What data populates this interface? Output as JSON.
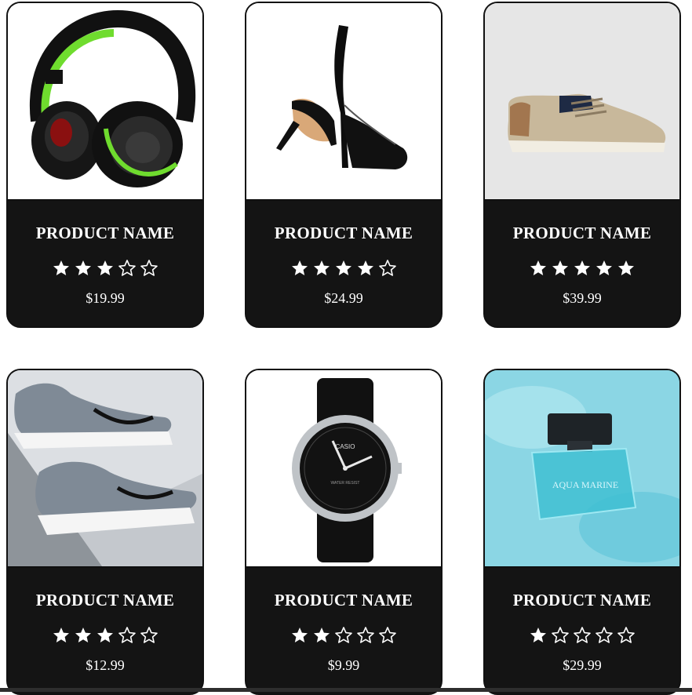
{
  "products": [
    {
      "name": "PRODUCT NAME",
      "rating": 3,
      "price": "$19.99",
      "image": "headphones-icon"
    },
    {
      "name": "PRODUCT NAME",
      "rating": 4,
      "price": "$24.99",
      "image": "high-heels-icon"
    },
    {
      "name": "PRODUCT NAME",
      "rating": 5,
      "price": "$39.99",
      "image": "casual-shoe-icon"
    },
    {
      "name": "PRODUCT NAME",
      "rating": 3,
      "price": "$12.99",
      "image": "sneakers-icon"
    },
    {
      "name": "PRODUCT NAME",
      "rating": 2,
      "price": "$9.99",
      "image": "wristwatch-icon"
    },
    {
      "name": "PRODUCT NAME",
      "rating": 1,
      "price": "$29.99",
      "image": "perfume-bottle-icon"
    }
  ],
  "max_rating": 5,
  "colors": {
    "card_bg": "#141414",
    "text": "#ffffff",
    "border": "#111111"
  },
  "watch_brand": "CASIO",
  "watch_subtext": "WATER RESIST",
  "perfume_label": "AQUA MARINE"
}
